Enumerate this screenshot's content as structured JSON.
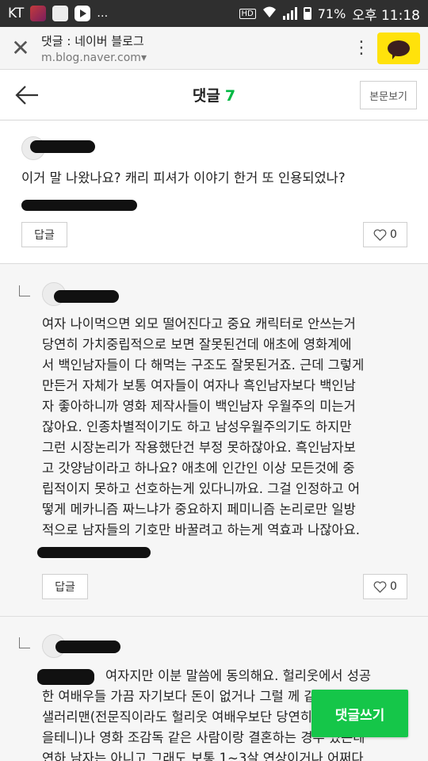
{
  "status_bar": {
    "carrier": "KT",
    "more": "…",
    "hd_badge": "HD",
    "battery_percent": "71%",
    "time": "오후 11:18"
  },
  "browser": {
    "title": "댓글 : 네이버 블로그",
    "url": "m.blog.naver.com▾",
    "menu_glyph": "⋮",
    "close_glyph": "✕"
  },
  "header": {
    "title": "댓글",
    "count": "7",
    "body_view_label": "본문보기"
  },
  "comments": [
    {
      "text_lines": [
        "이거 말 나왔나요? 캐리 피셔가 이야기 한거 또 인용되었나?"
      ],
      "reply_label": "답글",
      "like_count": "0"
    },
    {
      "text_lines": [
        "여자 나이먹으면 외모 떨어진다고 중요 캐릭터로 안쓰는거",
        "당연히 가치중립적으로 보면 잘못된건데 애초에 영화계에",
        "서 백인남자들이 다 해먹는 구조도 잘못된거죠. 근데 그렇게",
        "만든거 자체가 보통 여자들이 여자나 흑인남자보다 백인남",
        "자 좋아하니까 영화 제작사들이 백인남자 우월주의 미는거",
        "잖아요. 인종차별적이기도 하고 남성우월주의기도 하지만",
        "그런 시장논리가 작용했단건 부정 못하잖아요. 흑인남자보",
        "고 갓양남이라고 하나요? 애초에 인간인 이상 모든것에 중",
        "립적이지 못하고 선호하는게 있다니까요. 그걸 인정하고 어",
        "떻게 메카니즘 짜느냐가 중요하지 페미니즘 논리로만 일방",
        "적으로 남자들의 기호만 바꿀려고 하는게 역효과 나잖아요."
      ],
      "reply_label": "답글",
      "like_count": "0"
    },
    {
      "text_lines": [
        "여자지만 이분 말씀에 동의해요. 헐리웃에서 성공",
        "한 여배우들 가끔 자기보다 돈이 없거나 그럴 께 같은 전문직",
        "샐러리맨(전문직이라도 헐리웃 여배우보단 당연히",
        "을테니)나 영화 조감독 같은 사람이랑 결혼하는 경우 있는데",
        "연하 남자는 아니고 그래도 보통 1~3살 연상이거나 어쩌다"
      ]
    }
  ],
  "write_button_label": "댓글쓰기"
}
